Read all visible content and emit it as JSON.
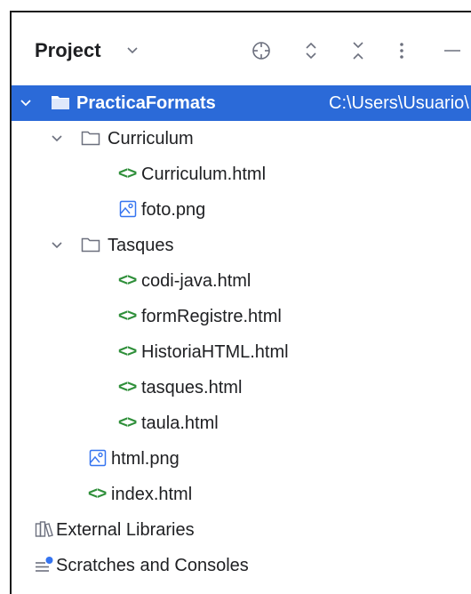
{
  "header": {
    "title": "Project",
    "icons": [
      "chevron-down-icon",
      "locate-icon",
      "expand-collapse-icon",
      "collapse-all-icon",
      "more-options-icon",
      "minimize-icon"
    ]
  },
  "tree": {
    "root": {
      "label": "PracticaFormats",
      "path": "C:\\Users\\Usuario\\"
    },
    "curriculum_folder": "Curriculum",
    "curriculum_html": "Curriculum.html",
    "foto_png": "foto.png",
    "tasques_folder": "Tasques",
    "codi_java": "codi-java.html",
    "form_registre": "formRegistre.html",
    "historia_html": "HistoriaHTML.html",
    "tasques_html": "tasques.html",
    "taula_html": "taula.html",
    "html_png": "html.png",
    "index_html": "index.html",
    "external_libraries": "External Libraries",
    "scratches": "Scratches and Consoles"
  },
  "colors": {
    "selection": "#2b6ad8",
    "html_icon": "#2f8f3a",
    "image_icon": "#3574f0",
    "text": "#1e1f22"
  }
}
